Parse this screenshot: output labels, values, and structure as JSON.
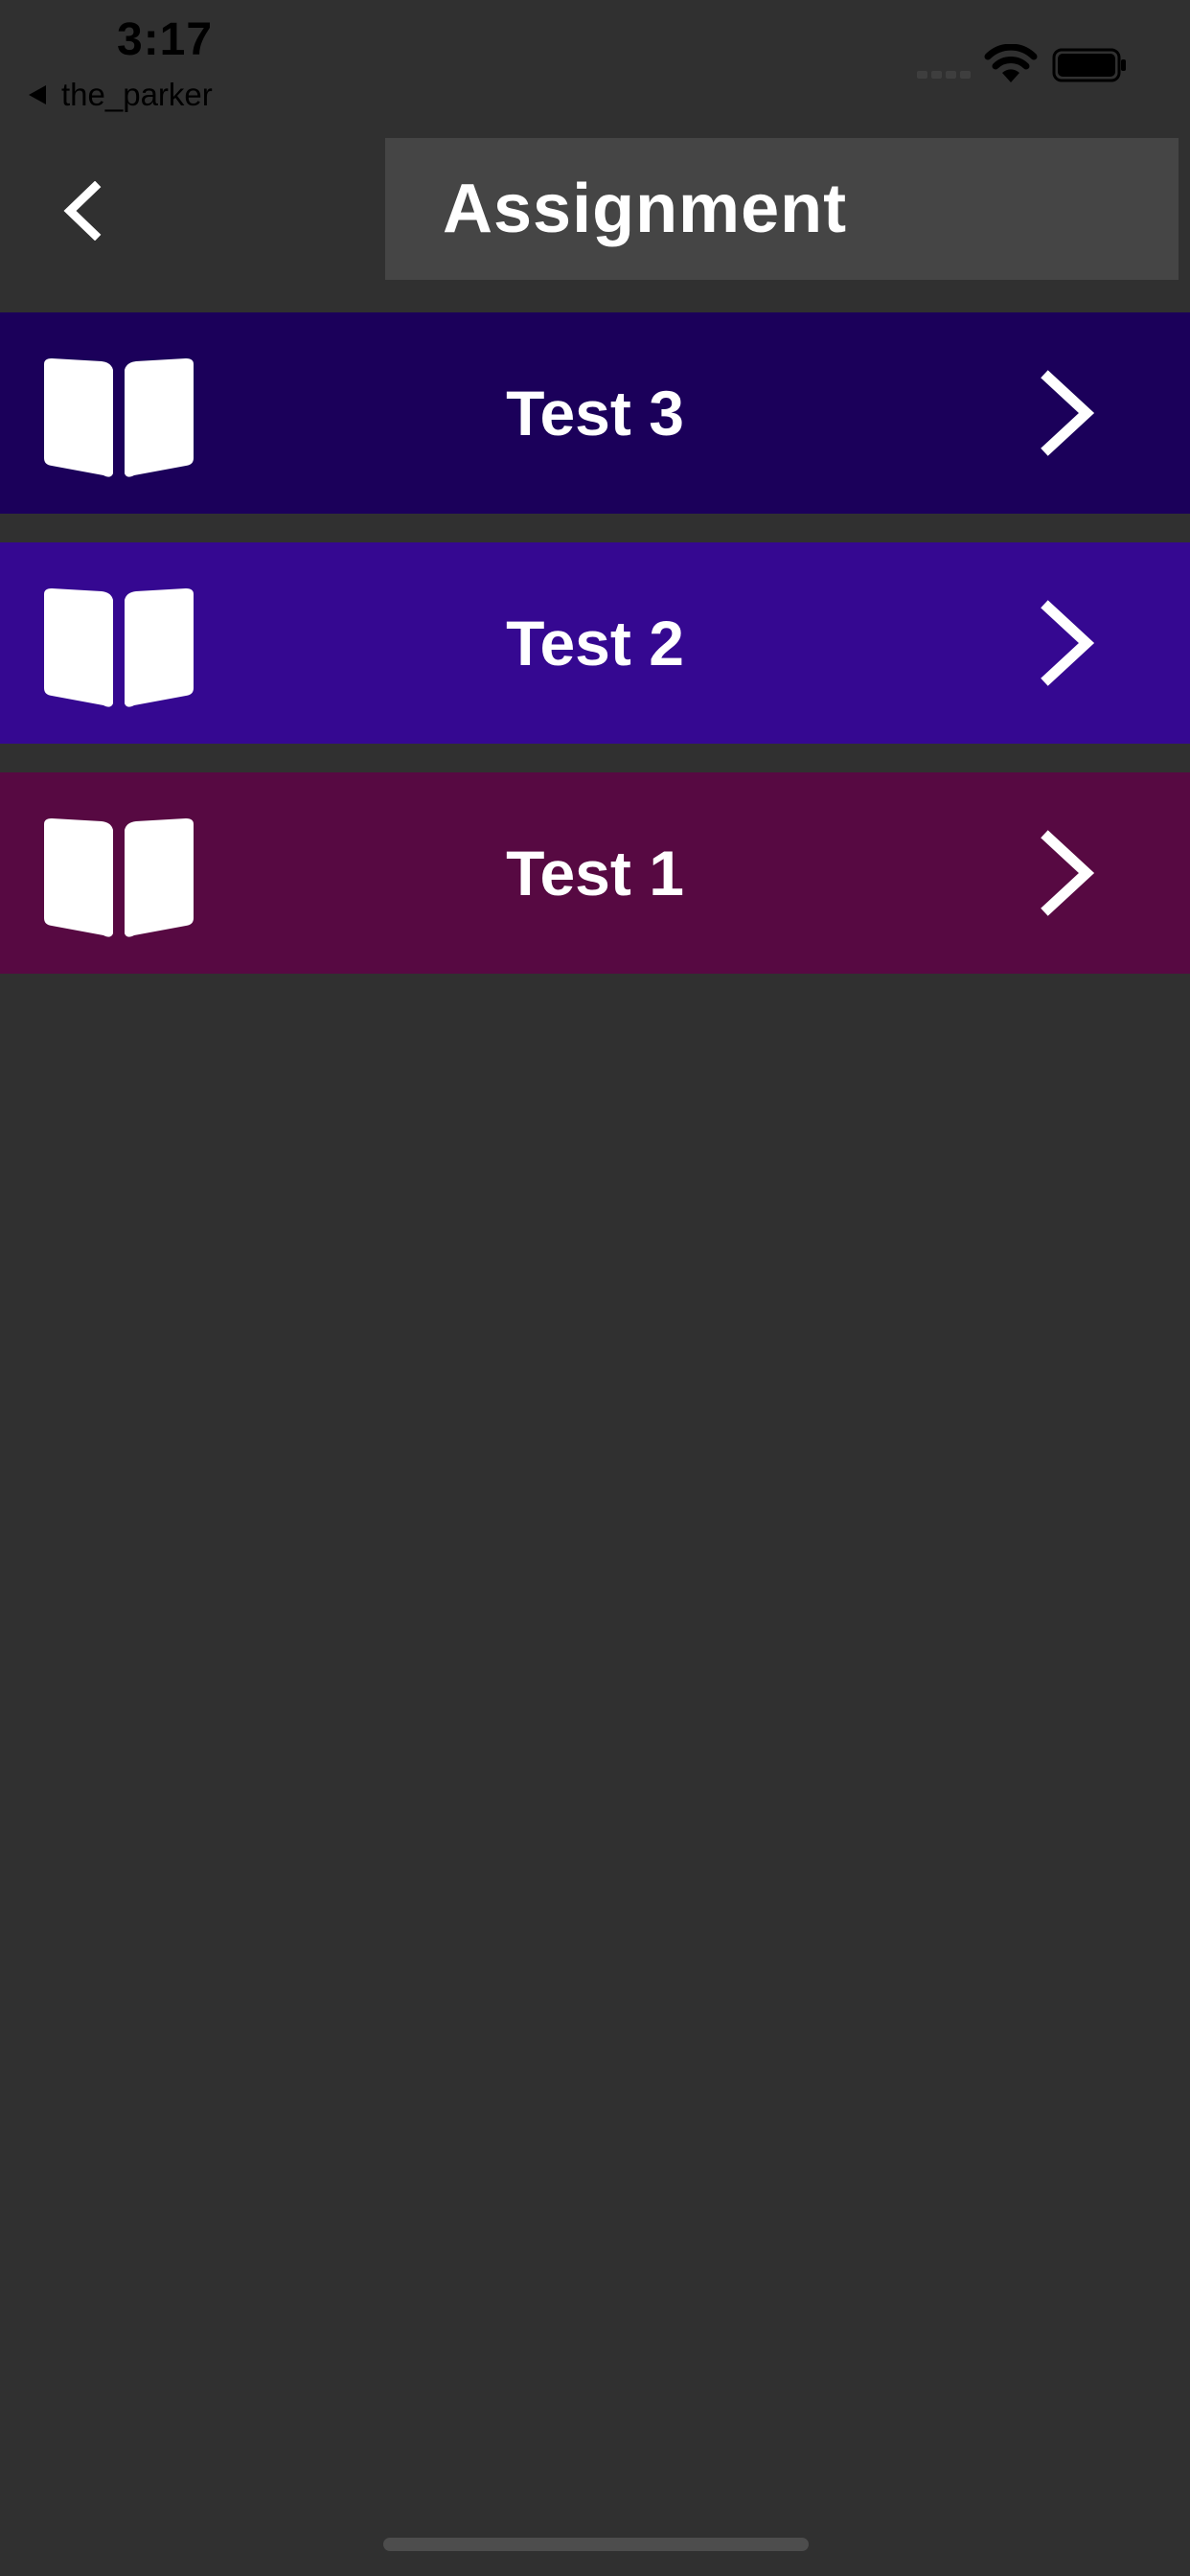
{
  "status_bar": {
    "time": "3:17",
    "back_app": "the_parker"
  },
  "header": {
    "title": "Assignment"
  },
  "assignments": [
    {
      "label": "Test 3",
      "color": "#1b005a",
      "icon": "book-open-icon"
    },
    {
      "label": "Test 2",
      "color": "#350891",
      "icon": "book-open-icon"
    },
    {
      "label": "Test 1",
      "color": "#570942",
      "icon": "book-open-icon"
    }
  ],
  "colors": {
    "background": "#303030",
    "title_box": "#454545",
    "text": "#ffffff"
  }
}
